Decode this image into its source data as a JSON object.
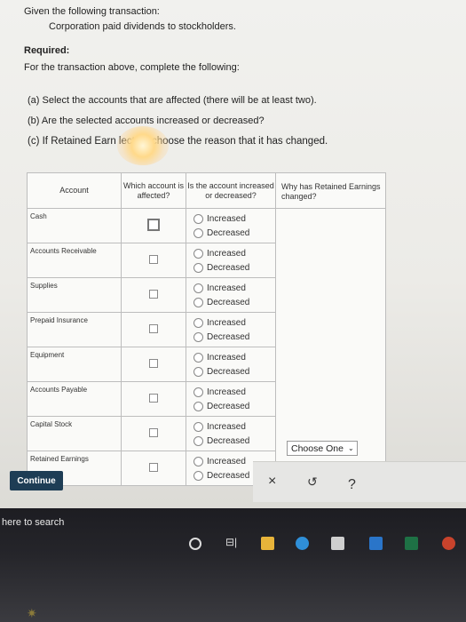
{
  "intro": "Given the following transaction:",
  "transaction": "Corporation paid dividends to stockholders.",
  "required_label": "Required:",
  "instructions": "For the transaction above, complete the following:",
  "steps": {
    "a": "(a)  Select the accounts that are affected (there will be at least two).",
    "b": "(b)  Are the selected accounts increased or decreased?",
    "c": "(c)  If Retained Earn         lected, choose the reason that it has changed."
  },
  "table": {
    "headers": {
      "account": "Account",
      "affected": "Which account is affected?",
      "inc_dec": "Is the account increased or decreased?",
      "why": "Why has Retained Earnings changed?"
    },
    "rows": [
      {
        "name": "Cash"
      },
      {
        "name": "Accounts Receivable"
      },
      {
        "name": "Supplies"
      },
      {
        "name": "Prepaid Insurance"
      },
      {
        "name": "Equipment"
      },
      {
        "name": "Accounts Payable"
      },
      {
        "name": "Capital Stock"
      },
      {
        "name": "Retained Earnings"
      }
    ],
    "increased_label": "Increased",
    "decreased_label": "Decreased"
  },
  "dropdown": {
    "selected": "Choose One"
  },
  "continue_label": "Continue",
  "taskbar": {
    "search_text": "here to search"
  },
  "icons": {
    "close": "×",
    "undo": "↺",
    "help": "?",
    "chevron": "⌄",
    "task_view": "⊟|"
  },
  "colors": {
    "continue_bg": "#1e3d55",
    "accent": "#2f8fd8"
  }
}
